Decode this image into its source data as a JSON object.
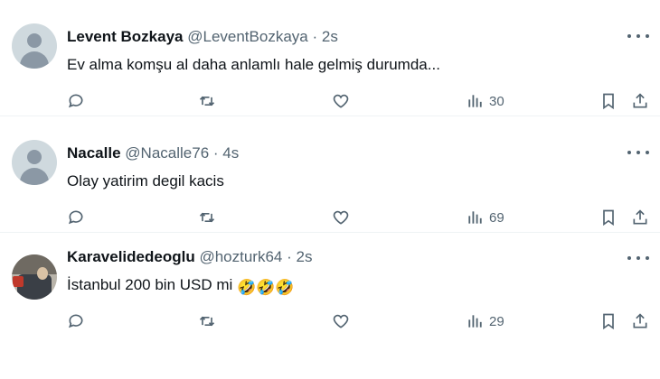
{
  "tweets": [
    {
      "name": "Levent Bozkaya",
      "handle": "@LeventBozkaya",
      "separator": "·",
      "time": "2s",
      "text": "Ev alma komşu al daha anlamlı hale gelmiş durumda...",
      "views": "30",
      "avatar": "default-avatar"
    },
    {
      "name": "Nacalle",
      "handle": "@Nacalle76",
      "separator": "·",
      "time": "4s",
      "text": "Olay yatirim degil kacis",
      "views": "69",
      "avatar": "default-avatar"
    },
    {
      "name": "Karavelidedeoglu",
      "handle": "@hozturk64",
      "separator": "·",
      "time": "2s",
      "text": "İstanbul 200 bin USD mi",
      "emoji": "🤣🤣🤣",
      "views": "29",
      "avatar": "photo-avatar"
    }
  ],
  "icons": {
    "reply": "reply-icon",
    "retweet": "retweet-icon",
    "like": "like-icon",
    "views": "views-icon",
    "bookmark": "bookmark-icon",
    "share": "share-icon",
    "more": "more-icon"
  },
  "colors": {
    "text": "#0f1419",
    "secondary": "#536471",
    "divider": "#eff3f4",
    "emoji": "#f7c21b"
  }
}
